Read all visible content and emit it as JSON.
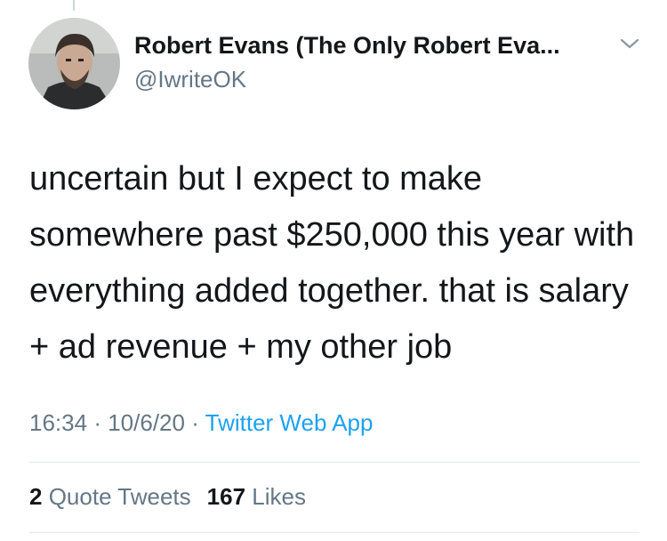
{
  "tweet": {
    "author": {
      "display_name": "Robert Evans (The Only Robert Eva...",
      "handle": "@IwriteOK"
    },
    "text": "uncertain but I expect to make somewhere past $250,000 this year with everything added together. that is salary + ad revenue + my other job",
    "time": "16:34",
    "separator": "·",
    "date": "10/6/20",
    "source": "Twitter Web App",
    "stats": {
      "quote_tweets_count": "2",
      "quote_tweets_label": "Quote Tweets",
      "likes_count": "167",
      "likes_label": "Likes"
    }
  },
  "icons": {
    "avatar": "avatar-photo",
    "more": "chevron-down-icon"
  },
  "colors": {
    "text": "#14171a",
    "secondary": "#657786",
    "link": "#1da1f2",
    "divider": "#e1e8ed"
  }
}
